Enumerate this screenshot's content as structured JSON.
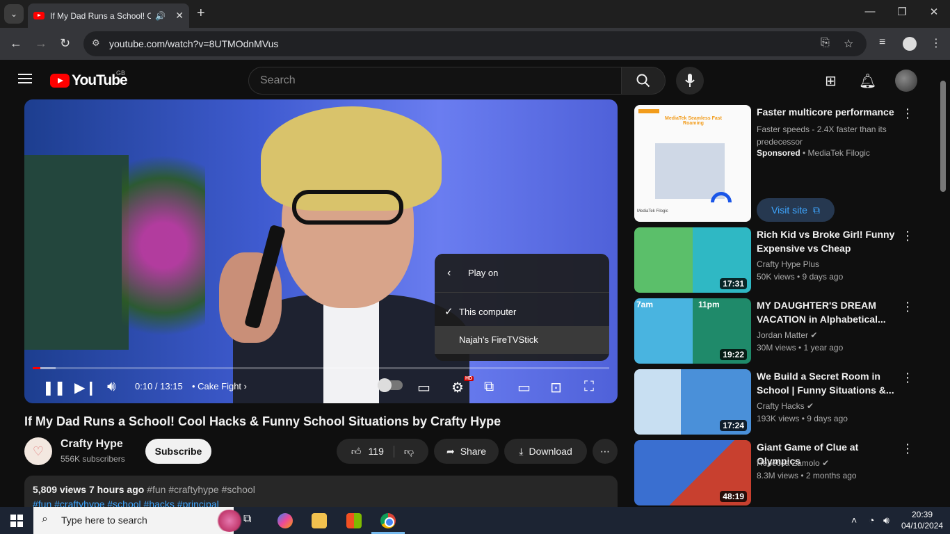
{
  "browser": {
    "tab_title": "If My Dad Runs a School! Co",
    "url": "youtube.com/watch?v=8UTMOdnMVus"
  },
  "youtube": {
    "logo_text": "YouTube",
    "country": "GB",
    "search_placeholder": "Search"
  },
  "player": {
    "time": "0:10 / 13:15",
    "chapter": "Cake Fight",
    "progress_fraction": 0.013,
    "buffered_fraction": 0.04,
    "hd_badge": "HD",
    "popup": {
      "title": "Play on",
      "options": [
        "This computer",
        "Najah's FireTVStick"
      ]
    }
  },
  "video": {
    "title": "If My Dad Runs a School! Cool Hacks & Funny School Situations by Crafty Hype",
    "channel": "Crafty Hype",
    "subscribers": "556K subscribers",
    "subscribe_label": "Subscribe",
    "likes": "119",
    "share_label": "Share",
    "download_label": "Download",
    "stats": "5,809 views  7 hours ago",
    "tags_inline": "#fun #craftyhype #school",
    "tags_line2": "#fun #craftyhype #school #hacks #principal"
  },
  "sidebar": {
    "ad": {
      "title": "Faster multicore performance",
      "desc": "Faster speeds - 2.4X faster than its predecessor",
      "sponsored": "Sponsored",
      "advertiser": "MediaTek Filogic",
      "visit_label": "Visit site",
      "image_headline": "MediaTek Seamless Fast Roaming",
      "image_brand": "MediaTek Filogic"
    },
    "items": [
      {
        "title": "Rich Kid vs Broke Girl! Funny Expensive vs Cheap Situation...",
        "channel": "Crafty Hype Plus",
        "meta": "50K views  •  9 days ago",
        "duration": "17:31",
        "color": "#3e8f4c"
      },
      {
        "title": "MY DAUGHTER'S DREAM VACATION in Alphabetical...",
        "channel": "Jordan Matter",
        "meta": "30M views  •  1 year ago",
        "duration": "19:22",
        "color": "#2f9fd6",
        "left_label": "7am",
        "right_label": "11pm"
      },
      {
        "title": "We Build a Secret Room in School | Funny Situations &...",
        "channel": "Crafty Hacks",
        "meta": "193K views  •  9 days ago",
        "duration": "17:24",
        "color": "#4a90d9"
      },
      {
        "title": "Giant Game of Clue at Olympics",
        "channel": "Rebecca Zamolo",
        "meta": "8.3M views  •  2 months ago",
        "duration": "48:19",
        "color": "#3a6fd0"
      }
    ]
  },
  "taskbar": {
    "search_placeholder": "Type here to search",
    "time": "20:39",
    "date": "04/10/2024"
  }
}
